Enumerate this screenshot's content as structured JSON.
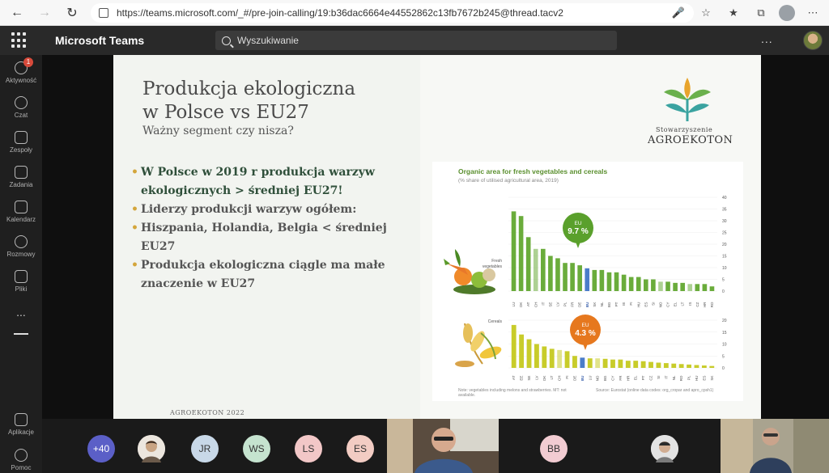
{
  "browser": {
    "url": "https://teams.microsoft.com/_#/pre-join-calling/19:b36dac6664e44552862c13fb7672b245@thread.tacv2"
  },
  "teams": {
    "app_name": "Microsoft Teams",
    "search_placeholder": "Wyszukiwanie",
    "more": "..."
  },
  "rail": {
    "items": [
      {
        "label": "Aktywność",
        "badge": "1"
      },
      {
        "label": "Czat"
      },
      {
        "label": "Zespoły"
      },
      {
        "label": "Zadania"
      },
      {
        "label": "Kalendarz"
      },
      {
        "label": "Rozmowy"
      },
      {
        "label": "Pliki"
      },
      {
        "label": "..."
      },
      {
        "label": "Aplikacje"
      },
      {
        "label": "Pomoc"
      }
    ]
  },
  "slide": {
    "title_line1": "Produkcja ekologiczna",
    "title_line2": "w Polsce vs EU27",
    "subtitle": "Ważny segment czy nisza?",
    "bullets": [
      {
        "text": "W Polsce w 2019 r produkcja warzyw ekologicznych  > średniej EU27!",
        "style": "green"
      },
      {
        "text": "Liderzy produkcji warzyw ogółem:",
        "style": "grey"
      },
      {
        "text": "Hiszpania, Holandia, Belgia < średniej EU27",
        "style": "grey"
      },
      {
        "text": "Produkcja ekologiczna ciągle ma małe znaczenie w EU27",
        "style": "grey"
      }
    ],
    "footer": "AGROEKOTON 2022",
    "logo_line1": "Stowarzyszenie",
    "logo_line2": "AGROEKOTON"
  },
  "chart_data": [
    {
      "type": "bar",
      "title": "Organic area for fresh vegetables and cereals",
      "subtitle": "(% share of utilised agricultural area, 2019)",
      "panel_label": "Fresh vegetables",
      "callout": {
        "label": "EU",
        "value": "9.7 %"
      },
      "ylim": [
        0,
        40
      ],
      "yticks": [
        0,
        5,
        10,
        15,
        20,
        25,
        30,
        35,
        40
      ],
      "categories": [
        "LU",
        "DK",
        "AT",
        "CH",
        "IT",
        "SE",
        "LV",
        "PL",
        "FR",
        "DE",
        "EU",
        "SK",
        "NL",
        "BG",
        "PT",
        "IE",
        "FI",
        "HU",
        "ES",
        "SI",
        "NO",
        "CY",
        "EL",
        "LT",
        "IS",
        "CZ",
        "HR",
        "RO"
      ],
      "values": [
        34,
        32,
        23,
        18,
        18,
        15,
        14,
        12,
        12,
        11,
        9.7,
        9,
        9,
        8,
        8,
        7,
        6,
        6,
        5,
        5,
        4,
        4,
        3.5,
        3.5,
        3,
        3,
        3,
        2
      ],
      "highlight": [
        "EU"
      ],
      "hatched": [
        "CH",
        "NO",
        "IS"
      ],
      "colors": {
        "bar": "#6aac3b",
        "eu": "#4a7cc9",
        "callout": "#5aa02c"
      }
    },
    {
      "type": "bar",
      "panel_label": "Cereals",
      "callout": {
        "label": "EU",
        "value": "4.3 %"
      },
      "ylim": [
        0,
        20
      ],
      "yticks": [
        0,
        5,
        10,
        15,
        20
      ],
      "categories": [
        "AT",
        "EE",
        "SE",
        "LV",
        "DK",
        "LT",
        "CH",
        "FI",
        "DE",
        "EU",
        "LU",
        "NO",
        "BG",
        "CY",
        "FR",
        "HR",
        "EL",
        "PT",
        "CZ",
        "SI",
        "IT",
        "NL",
        "RO",
        "PL",
        "HU",
        "ES",
        "SK"
      ],
      "values": [
        18,
        14,
        12,
        10,
        9,
        8,
        7.5,
        7,
        5,
        4.3,
        4,
        4,
        3.8,
        3.5,
        3.5,
        3,
        3,
        2.8,
        2.5,
        2.2,
        2,
        1.8,
        1.6,
        1.4,
        1.2,
        1,
        0.8
      ],
      "highlight": [
        "EU"
      ],
      "hatched": [
        "CH",
        "NO"
      ],
      "colors": {
        "bar": "#c8cc2a",
        "eu": "#4a7cc9",
        "callout": "#e6781e"
      }
    }
  ],
  "chart_notes": {
    "note": "Note: vegetables including melons and strawberries. MT: not available.",
    "source": "Source: Eurostat (online data codes: org_cropar and apro_cpsh1)"
  },
  "participants": {
    "more_count": "+40",
    "initials": [
      "JR",
      "WS",
      "LS",
      "ES",
      "BB"
    ],
    "avatar_colors": [
      "#c8d8e8",
      "#c5e3cf",
      "#f2c7c7",
      "#f2ccc3",
      "#f2ccd2"
    ]
  }
}
